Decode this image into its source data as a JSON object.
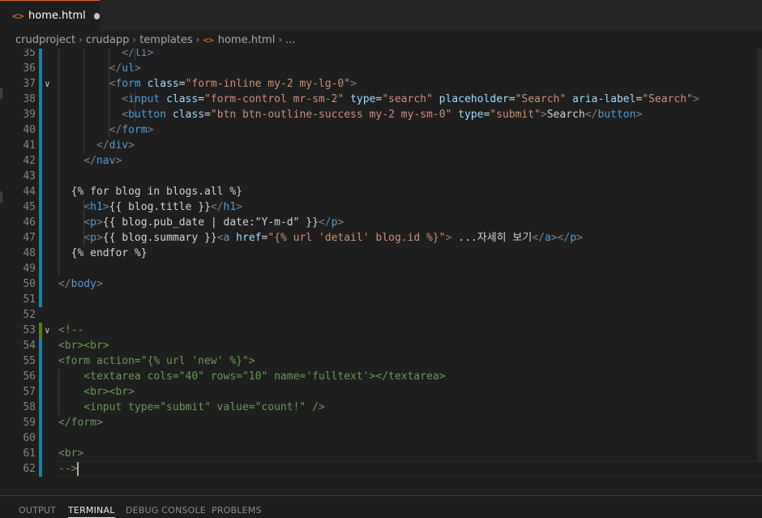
{
  "tab": {
    "icon": "html-file-icon",
    "label": "home.html",
    "dirty": true
  },
  "breadcrumb": {
    "items": [
      "crudproject",
      "crudapp",
      "templates"
    ],
    "file": "home.html",
    "more": "..."
  },
  "editor": {
    "lines": [
      {
        "n": "35",
        "segs": [
          [
            "x",
            "          "
          ],
          [
            "t",
            "</"
          ],
          [
            "n",
            "li"
          ],
          [
            "t",
            ">"
          ]
        ]
      },
      {
        "n": "36",
        "segs": [
          [
            "x",
            "        "
          ],
          [
            "t",
            "</"
          ],
          [
            "n",
            "ul"
          ],
          [
            "t",
            ">"
          ]
        ]
      },
      {
        "n": "37",
        "segs": [
          [
            "x",
            "        "
          ],
          [
            "t",
            "<"
          ],
          [
            "n",
            "form"
          ],
          [
            "x",
            " "
          ],
          [
            "a",
            "class"
          ],
          [
            "x",
            "="
          ],
          [
            "s",
            "\"form-inline my-2 my-lg-0\""
          ],
          [
            "t",
            ">"
          ]
        ]
      },
      {
        "n": "38",
        "segs": [
          [
            "x",
            "          "
          ],
          [
            "t",
            "<"
          ],
          [
            "n",
            "input"
          ],
          [
            "x",
            " "
          ],
          [
            "a",
            "class"
          ],
          [
            "x",
            "="
          ],
          [
            "s",
            "\"form-control mr-sm-2\""
          ],
          [
            "x",
            " "
          ],
          [
            "a",
            "type"
          ],
          [
            "x",
            "="
          ],
          [
            "s",
            "\"search\""
          ],
          [
            "x",
            " "
          ],
          [
            "a",
            "placeholder"
          ],
          [
            "x",
            "="
          ],
          [
            "s",
            "\"Search\""
          ],
          [
            "x",
            " "
          ],
          [
            "a",
            "aria-label"
          ],
          [
            "x",
            "="
          ],
          [
            "s",
            "\"Search\""
          ],
          [
            "t",
            ">"
          ]
        ]
      },
      {
        "n": "39",
        "segs": [
          [
            "x",
            "          "
          ],
          [
            "t",
            "<"
          ],
          [
            "n",
            "button"
          ],
          [
            "x",
            " "
          ],
          [
            "a",
            "class"
          ],
          [
            "x",
            "="
          ],
          [
            "s",
            "\"btn btn-outline-success my-2 my-sm-0\""
          ],
          [
            "x",
            " "
          ],
          [
            "a",
            "type"
          ],
          [
            "x",
            "="
          ],
          [
            "s",
            "\"submit\""
          ],
          [
            "t",
            ">"
          ],
          [
            "x",
            "Search"
          ],
          [
            "t",
            "</"
          ],
          [
            "n",
            "button"
          ],
          [
            "t",
            ">"
          ]
        ]
      },
      {
        "n": "40",
        "segs": [
          [
            "x",
            "        "
          ],
          [
            "t",
            "</"
          ],
          [
            "n",
            "form"
          ],
          [
            "t",
            ">"
          ]
        ]
      },
      {
        "n": "41",
        "segs": [
          [
            "x",
            "      "
          ],
          [
            "t",
            "</"
          ],
          [
            "n",
            "div"
          ],
          [
            "t",
            ">"
          ]
        ]
      },
      {
        "n": "42",
        "segs": [
          [
            "x",
            "    "
          ],
          [
            "t",
            "</"
          ],
          [
            "n",
            "nav"
          ],
          [
            "t",
            ">"
          ]
        ]
      },
      {
        "n": "43",
        "segs": []
      },
      {
        "n": "44",
        "segs": [
          [
            "x",
            "  {% for blog in blogs.all %}"
          ]
        ]
      },
      {
        "n": "45",
        "segs": [
          [
            "x",
            "    "
          ],
          [
            "t",
            "<"
          ],
          [
            "n",
            "h1"
          ],
          [
            "t",
            ">"
          ],
          [
            "x",
            "{{ blog.title }}"
          ],
          [
            "t",
            "</"
          ],
          [
            "n",
            "h1"
          ],
          [
            "t",
            ">"
          ]
        ]
      },
      {
        "n": "46",
        "segs": [
          [
            "x",
            "    "
          ],
          [
            "t",
            "<"
          ],
          [
            "n",
            "p"
          ],
          [
            "t",
            ">"
          ],
          [
            "x",
            "{{ blog.pub_date | date:\"Y-m-d\" }}"
          ],
          [
            "t",
            "</"
          ],
          [
            "n",
            "p"
          ],
          [
            "t",
            ">"
          ]
        ]
      },
      {
        "n": "47",
        "segs": [
          [
            "x",
            "    "
          ],
          [
            "t",
            "<"
          ],
          [
            "n",
            "p"
          ],
          [
            "t",
            ">"
          ],
          [
            "x",
            "{{ blog.summary }}"
          ],
          [
            "t",
            "<"
          ],
          [
            "n",
            "a"
          ],
          [
            "x",
            " "
          ],
          [
            "a",
            "href"
          ],
          [
            "x",
            "="
          ],
          [
            "s",
            "\"{% url 'detail' blog.id %}\""
          ],
          [
            "t",
            ">"
          ],
          [
            "x",
            " ...자세히 보기"
          ],
          [
            "t",
            "</"
          ],
          [
            "n",
            "a"
          ],
          [
            "t",
            "></"
          ],
          [
            "n",
            "p"
          ],
          [
            "t",
            ">"
          ]
        ]
      },
      {
        "n": "48",
        "segs": [
          [
            "x",
            "  {% endfor %}"
          ]
        ]
      },
      {
        "n": "49",
        "segs": []
      },
      {
        "n": "50",
        "segs": [
          [
            "t",
            "</"
          ],
          [
            "n",
            "body"
          ],
          [
            "t",
            ">"
          ]
        ]
      },
      {
        "n": "51",
        "segs": []
      },
      {
        "n": "52",
        "segs": []
      },
      {
        "n": "53",
        "segs": [
          [
            "c",
            "<!--"
          ]
        ]
      },
      {
        "n": "54",
        "segs": [
          [
            "c",
            "<br><br>"
          ]
        ]
      },
      {
        "n": "55",
        "segs": [
          [
            "c",
            "<form action=\"{% url 'new' %}\">"
          ]
        ]
      },
      {
        "n": "56",
        "segs": [
          [
            "c",
            "    <textarea cols=\"40\" rows=\"10\" name='fulltext'></textarea>"
          ]
        ]
      },
      {
        "n": "57",
        "segs": [
          [
            "c",
            "    <br><br>"
          ]
        ]
      },
      {
        "n": "58",
        "segs": [
          [
            "c",
            "    <input type=\"submit\" value=\"count!\" />"
          ]
        ]
      },
      {
        "n": "59",
        "segs": [
          [
            "c",
            "</form>"
          ]
        ]
      },
      {
        "n": "60",
        "segs": []
      },
      {
        "n": "61",
        "segs": [
          [
            "c",
            "<br>"
          ]
        ]
      },
      {
        "n": "62",
        "segs": [
          [
            "c",
            "-->"
          ]
        ]
      }
    ]
  },
  "panel": {
    "tabs": [
      "OUTPUT",
      "TERMINAL",
      "DEBUG CONSOLE",
      "PROBLEMS"
    ],
    "active": "TERMINAL"
  },
  "colors": {
    "accent_modified": "#1b81a8",
    "accent_added": "#587c0c",
    "tab_top_border": "#e2662a"
  }
}
